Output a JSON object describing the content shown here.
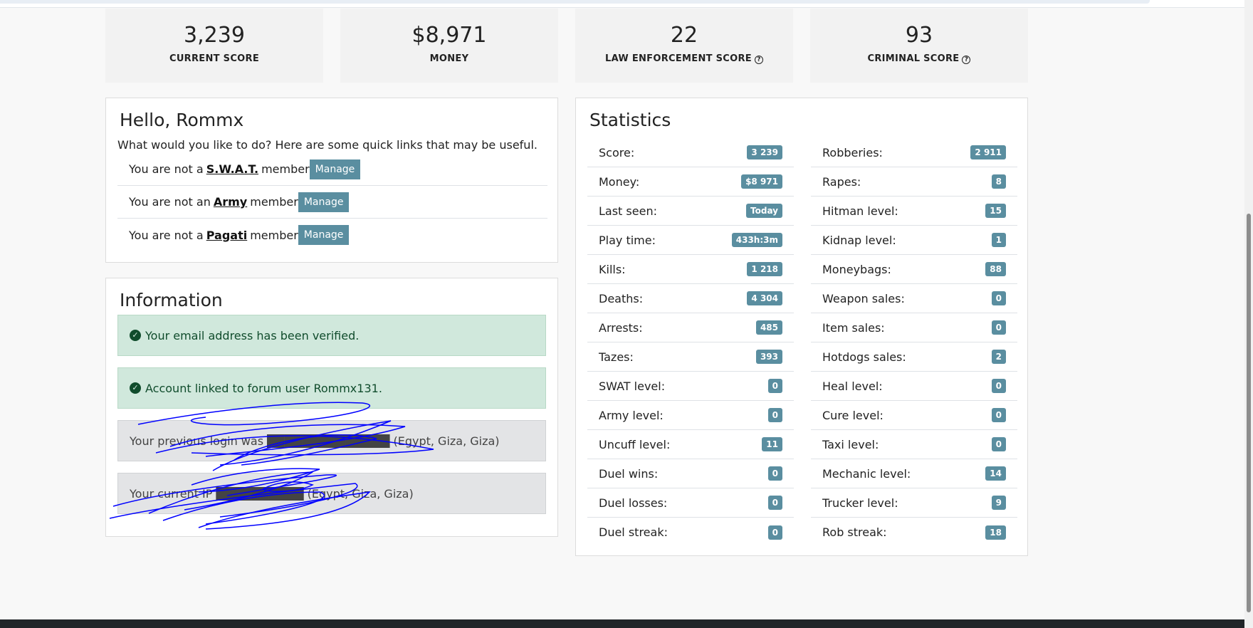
{
  "summary": [
    {
      "value": "3,239",
      "label": "CURRENT SCORE",
      "help": false
    },
    {
      "value": "$8,971",
      "label": "MONEY",
      "help": false
    },
    {
      "value": "22",
      "label": "LAW ENFORCEMENT SCORE",
      "help": true
    },
    {
      "value": "93",
      "label": "CRIMINAL SCORE",
      "help": true
    }
  ],
  "hello": {
    "title": "Hello, Rommx",
    "intro": "What would you like to do? Here are some quick links that may be useful.",
    "memberships": [
      {
        "prefix": "You are not a",
        "group": "S.W.A.T.",
        "suffix": "member",
        "button": "Manage"
      },
      {
        "prefix": "You are not an",
        "group": "Army",
        "suffix": "member",
        "button": "Manage"
      },
      {
        "prefix": "You are not a",
        "group": "Pagati",
        "suffix": "member",
        "button": "Manage"
      }
    ]
  },
  "information": {
    "title": "Information",
    "alerts": [
      {
        "type": "success",
        "text": "Your email address has been verified."
      },
      {
        "type": "success",
        "text": "Account linked to forum user Rommx131."
      },
      {
        "type": "neutral",
        "text": "Your previous login was ██████████████ (Egypt, Giza, Giza)"
      },
      {
        "type": "neutral",
        "text": "Your current IP ██████████ (Egypt, Giza, Giza)"
      }
    ]
  },
  "statistics": {
    "title": "Statistics",
    "left": [
      {
        "label": "Score:",
        "value": "3 239"
      },
      {
        "label": "Money:",
        "value": "$8 971"
      },
      {
        "label": "Last seen:",
        "value": "Today"
      },
      {
        "label": "Play time:",
        "value": "433h:3m"
      },
      {
        "label": "Kills:",
        "value": "1 218"
      },
      {
        "label": "Deaths:",
        "value": "4 304"
      },
      {
        "label": "Arrests:",
        "value": "485"
      },
      {
        "label": "Tazes:",
        "value": "393"
      },
      {
        "label": "SWAT level:",
        "value": "0"
      },
      {
        "label": "Army level:",
        "value": "0"
      },
      {
        "label": "Uncuff level:",
        "value": "11"
      },
      {
        "label": "Duel wins:",
        "value": "0"
      },
      {
        "label": "Duel losses:",
        "value": "0"
      },
      {
        "label": "Duel streak:",
        "value": "0"
      }
    ],
    "right": [
      {
        "label": "Robberies:",
        "value": "2 911"
      },
      {
        "label": "Rapes:",
        "value": "8"
      },
      {
        "label": "Hitman level:",
        "value": "15"
      },
      {
        "label": "Kidnap level:",
        "value": "1"
      },
      {
        "label": "Moneybags:",
        "value": "88"
      },
      {
        "label": "Weapon sales:",
        "value": "0"
      },
      {
        "label": "Item sales:",
        "value": "0"
      },
      {
        "label": "Hotdogs sales:",
        "value": "2"
      },
      {
        "label": "Heal level:",
        "value": "0"
      },
      {
        "label": "Cure level:",
        "value": "0"
      },
      {
        "label": "Taxi level:",
        "value": "0"
      },
      {
        "label": "Mechanic level:",
        "value": "14"
      },
      {
        "label": "Trucker level:",
        "value": "9"
      },
      {
        "label": "Rob streak:",
        "value": "18"
      }
    ]
  },
  "colors": {
    "badge": "#5a8ea0",
    "success_bg": "#d0e8dc",
    "neutral_bg": "#e3e4e6",
    "redaction": "#0000ff"
  }
}
